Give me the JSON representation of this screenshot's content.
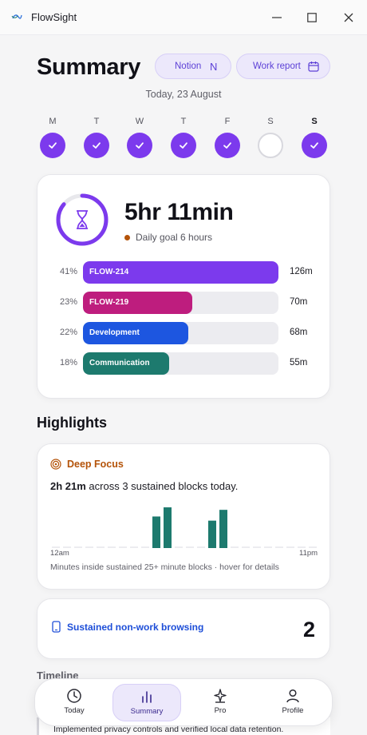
{
  "window": {
    "title": "FlowSight",
    "minimize_icon": "minimize-icon",
    "maximize_icon": "maximize-icon",
    "close_icon": "close-icon"
  },
  "header": {
    "title": "Summary",
    "notion_label": "Notion",
    "notion_glyph": "N",
    "report_label": "Work report",
    "date": "Today, 23 August"
  },
  "week": [
    {
      "letter": "M",
      "done": true,
      "today": false
    },
    {
      "letter": "T",
      "done": true,
      "today": false
    },
    {
      "letter": "W",
      "done": true,
      "today": false
    },
    {
      "letter": "T",
      "done": true,
      "today": false
    },
    {
      "letter": "F",
      "done": true,
      "today": false
    },
    {
      "letter": "S",
      "done": false,
      "today": false
    },
    {
      "letter": "S",
      "done": true,
      "today": true
    }
  ],
  "summary": {
    "total_time": "5hr 11min",
    "goal_text": "Daily goal 6 hours",
    "goal_progress": 0.86,
    "colors": {
      "accent": "#7c3aed",
      "goal_dot": "#b45309"
    },
    "breakdown": [
      {
        "pct": "41%",
        "label": "FLOW-214",
        "value": "126m",
        "fraction": 1.0,
        "color": "#7c3aed"
      },
      {
        "pct": "23%",
        "label": "FLOW-219",
        "value": "70m",
        "fraction": 0.56,
        "color": "#be1d7e"
      },
      {
        "pct": "22%",
        "label": "Development",
        "value": "68m",
        "fraction": 0.54,
        "color": "#1d56e0"
      },
      {
        "pct": "18%",
        "label": "Communication",
        "value": "55m",
        "fraction": 0.44,
        "color": "#1d7a6e"
      }
    ]
  },
  "highlights": {
    "title": "Highlights",
    "deep_focus": {
      "label": "Deep Focus",
      "time": "2h 21m",
      "description": " across 3 sustained blocks today.",
      "axis_start": "12am",
      "axis_end": "11pm",
      "caption": "Minutes inside sustained 25+ minute blocks · hover for details",
      "bar_color": "#1d7a6e",
      "baseline_color": "#ececf0",
      "blocks": [
        {
          "slot": 9,
          "level": 0.76
        },
        {
          "slot": 10,
          "level": 0.98
        },
        {
          "slot": 14,
          "level": 0.66
        },
        {
          "slot": 15,
          "level": 0.92
        }
      ]
    },
    "browsing": {
      "label": "Sustained non-work browsing",
      "count": "2"
    }
  },
  "timeline": {
    "title": "Timeline",
    "peek_text": "Implemented privacy controls and verified local data retention."
  },
  "nav": [
    {
      "label": "Today",
      "icon": "clock-icon",
      "active": false
    },
    {
      "label": "Summary",
      "icon": "bar-chart-icon",
      "active": true
    },
    {
      "label": "Pro",
      "icon": "sparkle-icon",
      "active": false
    },
    {
      "label": "Profile",
      "icon": "user-icon",
      "active": false
    }
  ]
}
